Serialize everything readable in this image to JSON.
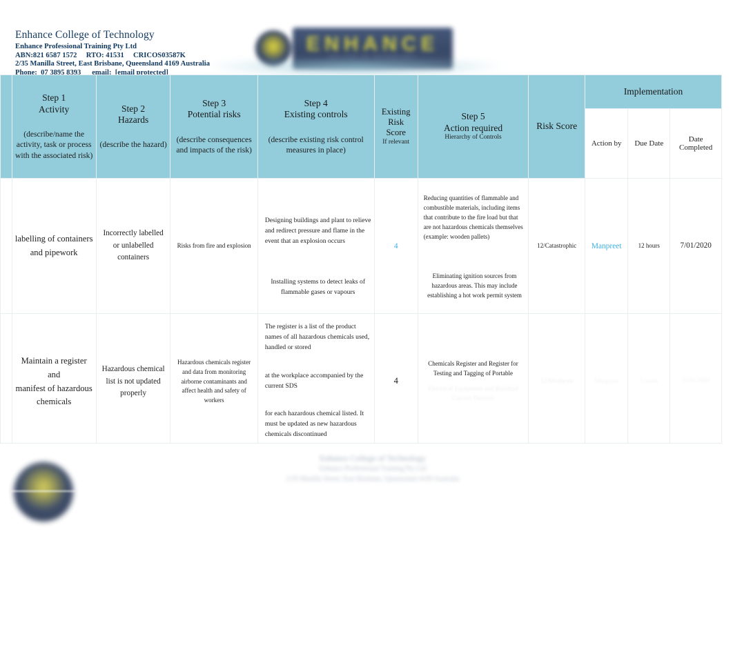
{
  "letterhead": {
    "org_name": "Enhance College of Technology",
    "legal_name": "Enhance Professional Training Pty Ltd",
    "registration_line": "ABN:821 6587 1572     RTO: 41531     CRICOS03587K",
    "address_line": "2/35 Manilla Street, East Brisbane, Queensland 4169 Australia",
    "contact_line": "Phone:  07 3895 8393      email:  [email protected]",
    "logo_word": "ENHANCE",
    "logo_subtext": "COLLEGE OF TECHNOLOGY",
    "text_color": "#12406b"
  },
  "table": {
    "header_bg": "#93ccda",
    "columns": [
      {
        "id": "step1",
        "title": "Step 1\nActivity",
        "subtitle": "(describe/name the activity, task or process with the associated risk)"
      },
      {
        "id": "step2",
        "title": "Step 2\nHazards",
        "subtitle": "(describe the hazard)"
      },
      {
        "id": "step3",
        "title": "Step 3\nPotential risks",
        "subtitle": "(describe consequences and impacts of the risk)"
      },
      {
        "id": "step4",
        "title": "Step 4\nExisting controls",
        "subtitle": "(describe existing risk control measures in place)"
      },
      {
        "id": "existing_risk_score",
        "title": "Existing\nRisk\nScore",
        "note": "If relevant"
      },
      {
        "id": "step5",
        "title": "Step 5\nAction required",
        "note": "Hierarchy of Controls"
      },
      {
        "id": "risk_score",
        "title": "Risk Score"
      }
    ],
    "implementation": {
      "group_label": "Implementation",
      "sub_columns": [
        "Action by",
        "Due Date",
        "Date Completed"
      ]
    },
    "rows": [
      {
        "activity": [
          "labelling of containers",
          "and pipework"
        ],
        "hazards": [
          "Incorrectly labelled",
          "or unlabelled",
          "containers"
        ],
        "potential_risks": [
          "Risks from fire and explosion"
        ],
        "existing_controls": [
          "Designing buildings and plant to relieve and redirect pressure and flame in the event that an explosion occurs",
          "Installing systems to detect leaks of flammable gases or vapours"
        ],
        "existing_risk_score": "4",
        "existing_risk_score_color": "#3fb0e0",
        "action_required": [
          "Reducing quantities of flammable and combustible materials, including items that contribute to the fire load but that are not hazardous chemicals themselves (example: wooden pallets)",
          "Eliminating ignition sources from hazardous areas. This may include establishing a hot work permit system"
        ],
        "risk_score": "12/Catastrophic",
        "action_by": "Manpreet",
        "action_by_color": "#3fb0e0",
        "due_date": "12 hours",
        "date_completed": "7/01/2020"
      },
      {
        "activity": [
          "Maintain a register and",
          "manifest of hazardous",
          "chemicals"
        ],
        "hazards": [
          "Hazardous chemical",
          "list is not updated",
          "properly"
        ],
        "potential_risks": [
          "Hazardous chemicals register and data from monitoring airborne contaminants and affect health and safety of workers"
        ],
        "existing_controls": [
          "The register is a list of the product names of all hazardous chemicals used, handled or stored",
          "at the workplace accompanied by the current SDS",
          "for each hazardous chemical listed. It must be updated as new hazardous chemicals discontinued"
        ],
        "existing_risk_score": "4",
        "existing_risk_score_color": "#1b1b1b",
        "action_required": [
          "Chemicals Register and Register for Testing and Tagging of Portable"
        ],
        "action_required_faded": "Electrical Equipment and Residual Current Devices",
        "risk_score": "",
        "risk_score_faded": "12/Moderate",
        "action_by": "",
        "action_by_faded": "Manpreet",
        "due_date": "",
        "due_date_faded": "1 week",
        "date_completed": "",
        "date_completed_faded": "15/01/2020"
      }
    ]
  },
  "footer": {
    "line1": "Enhance College of Technology",
    "line2": "Enhance Professional Training Pty Ltd",
    "line3": "2/35 Manilla Street, East Brisbane, Queensland 4169 Australia"
  }
}
